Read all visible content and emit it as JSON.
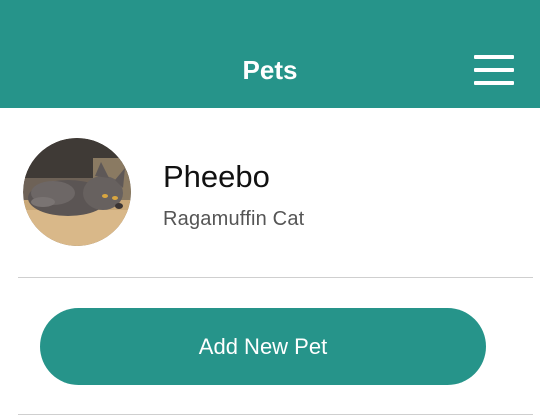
{
  "header": {
    "title": "Pets",
    "menu_icon": "hamburger-menu-icon",
    "background_color": "#26948a",
    "title_color": "#ffffff"
  },
  "pets": [
    {
      "name": "Pheebo",
      "breed": "Ragamuffin Cat"
    }
  ],
  "actions": {
    "add_label": "Add New Pet",
    "button_color": "#26948a"
  }
}
